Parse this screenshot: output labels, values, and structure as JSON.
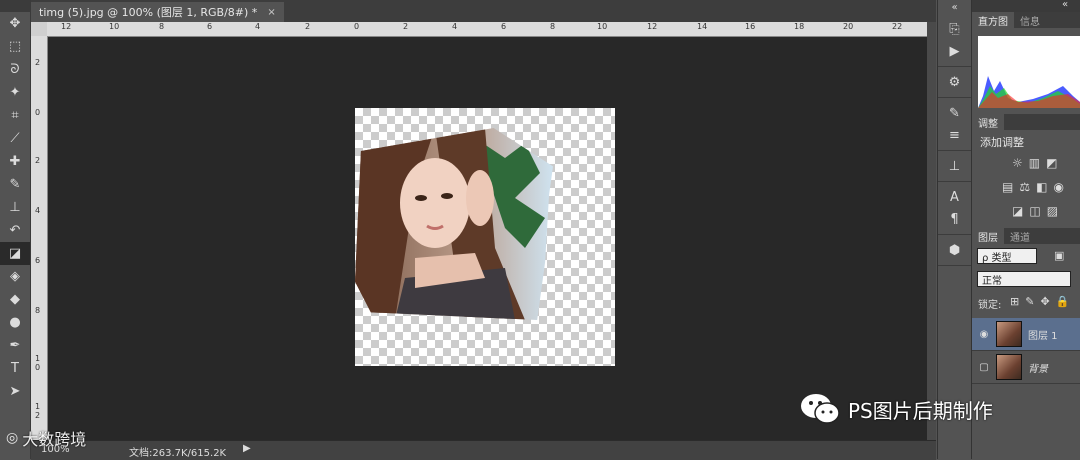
{
  "document": {
    "tab_title": "timg (5).jpg @ 100% (图层 1, RGB/8#) *",
    "close_glyph": "×"
  },
  "rulers": {
    "h_numbers": [
      "12",
      "10",
      "8",
      "6",
      "4",
      "2",
      "0",
      "2",
      "4",
      "6",
      "8",
      "10",
      "12",
      "14",
      "16",
      "18",
      "20",
      "22"
    ],
    "v_numbers": [
      "2",
      "0",
      "2",
      "4",
      "6",
      "8",
      "1 0",
      "1 2"
    ]
  },
  "status": {
    "zoom": "100%",
    "doc_info": "文档:263.7K/615.2K",
    "arrow": "▶"
  },
  "panels": {
    "collapse_glyph": "«",
    "histogram": {
      "tabs": [
        "直方图",
        "信息"
      ]
    },
    "adjustments": {
      "tab": "调整",
      "title": "添加调整"
    },
    "layers": {
      "tabs": [
        "图层",
        "通道"
      ],
      "filter_kind": "ρ 类型",
      "blend_mode": "正常",
      "lock_label": "锁定:",
      "items": [
        {
          "name": "图层 1",
          "selected": true,
          "visible": true
        },
        {
          "name": "背景",
          "selected": false,
          "visible": false
        }
      ]
    }
  },
  "watermarks": {
    "wechat": "PS图片后期制作",
    "bottom_left": "大数跨境"
  },
  "icons": {
    "toolbar": [
      "move-icon",
      "marquee-icon",
      "lasso-icon",
      "magic-wand-icon",
      "crop-icon",
      "eyedropper-icon",
      "healing-brush-icon",
      "brush-icon",
      "clone-stamp-icon",
      "history-brush-icon",
      "eraser-icon",
      "paint-bucket-icon",
      "blur-icon",
      "dodge-icon",
      "pen-icon",
      "type-icon",
      "path-selection-icon"
    ]
  }
}
